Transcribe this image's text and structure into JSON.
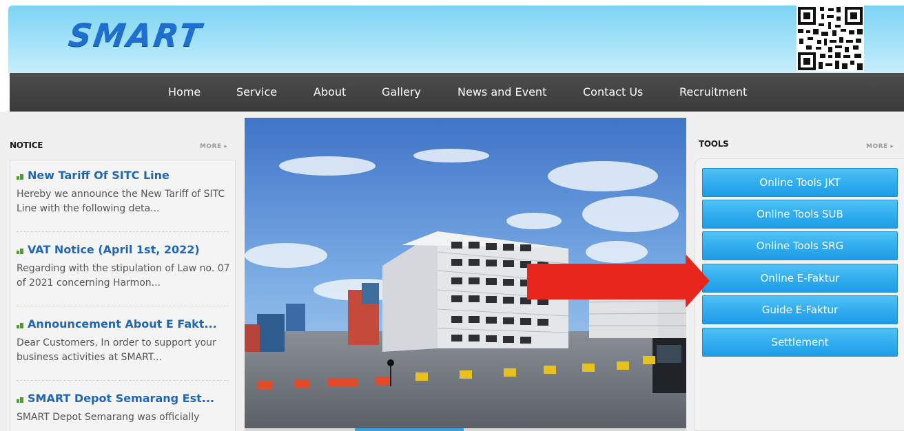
{
  "brand": {
    "logo_text": "SMART"
  },
  "nav": {
    "items": [
      "Home",
      "Service",
      "About",
      "Gallery",
      "News and Event",
      "Contact Us",
      "Recruitment"
    ]
  },
  "notice": {
    "title": "NOTICE",
    "more": "MORE ▸",
    "items": [
      {
        "title": "New Tariff Of SITC Line",
        "desc": "Hereby we announce the New Tariff of SITC Line with the following deta..."
      },
      {
        "title": "VAT Notice (April 1st, 2022)",
        "desc": "Regarding with the stipulation of Law no. 07 of 2021 concerning Harmon..."
      },
      {
        "title": "Announcement About E Fakt...",
        "desc": "Dear Customers, In order to support your business activities at SMART..."
      },
      {
        "title": "SMART Depot Semarang Est...",
        "desc": "SMART Depot Semarang was officially"
      }
    ]
  },
  "tools": {
    "title": "TOOLS",
    "more": "MORE ▸",
    "buttons": [
      "Online Tools JKT",
      "Online Tools SUB",
      "Online Tools SRG",
      "Online E-Faktur",
      "Guide E-Faktur",
      "Settlement"
    ]
  },
  "colors": {
    "header_blue": "#7dd3f3",
    "nav_dark": "#404040",
    "link_blue": "#1e66b8",
    "tool_button": "#31aef0",
    "arrow_red": "#e8261c",
    "icon_green": "#4aa02c"
  },
  "icons": {
    "qr": "qr-code-icon",
    "news_bullet": "bar-chart-bullet-icon",
    "annotation": "red-arrow-icon"
  }
}
